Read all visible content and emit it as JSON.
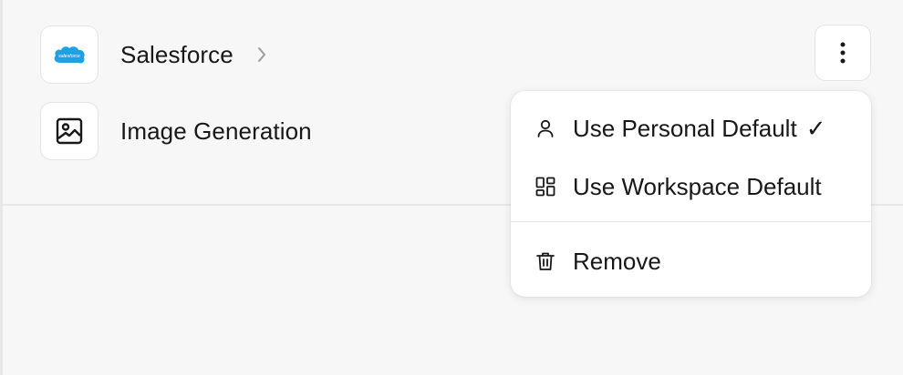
{
  "integrations": [
    {
      "label": "Salesforce",
      "icon": "salesforce-logo-icon",
      "logo_text": "salesforce"
    },
    {
      "label": "Image Generation",
      "icon": "image-icon"
    }
  ],
  "menu": {
    "items": [
      {
        "label": "Use Personal Default",
        "icon": "user-icon",
        "checked": true,
        "check_mark": "✓"
      },
      {
        "label": "Use Workspace Default",
        "icon": "grid-icon"
      },
      {
        "label": "Remove",
        "icon": "trash-icon"
      }
    ]
  },
  "colors": {
    "salesforce_blue": "#1ea1e0",
    "background": "#f7f7f8"
  }
}
